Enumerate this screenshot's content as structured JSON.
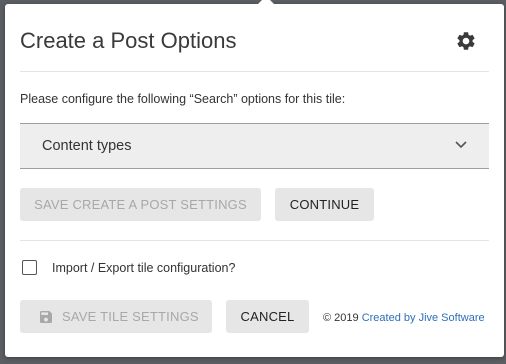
{
  "dialog": {
    "title": "Create a Post Options",
    "settings_icon": "gear-icon",
    "description": "Please configure the following “Search” options for this tile:"
  },
  "content_types": {
    "label": "Content types",
    "icon": "chevron-down-icon"
  },
  "buttons": {
    "save_post_settings": "SAVE CREATE A POST SETTINGS",
    "continue": "CONTINUE",
    "save_tile_settings": "SAVE TILE SETTINGS",
    "save_tile_icon": "floppy-disk-icon",
    "cancel": "CANCEL"
  },
  "import_export": {
    "label": "Import / Export tile configuration?",
    "checked": false
  },
  "footer": {
    "copyright": "© 2019",
    "link_text": "Created by Jive Software"
  },
  "colors": {
    "overlay": "#5b5e63",
    "link": "#2f6fb8",
    "button_bg": "#e6e6e6",
    "disabled_text": "#a8a8a8"
  }
}
